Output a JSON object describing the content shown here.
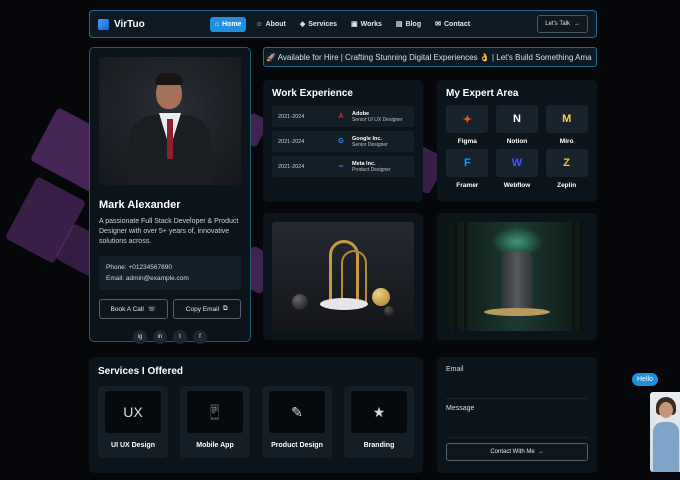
{
  "nav": {
    "logo": "VirTuo",
    "links": [
      {
        "label": "Home",
        "icon": "home-icon",
        "glyph": "⌂"
      },
      {
        "label": "About",
        "icon": "user-icon",
        "glyph": "☺"
      },
      {
        "label": "Services",
        "icon": "layers-icon",
        "glyph": "◈"
      },
      {
        "label": "Works",
        "icon": "briefcase-icon",
        "glyph": "▣"
      },
      {
        "label": "Blog",
        "icon": "book-icon",
        "glyph": "▤"
      },
      {
        "label": "Contact",
        "icon": "mail-icon",
        "glyph": "✉"
      }
    ],
    "cta": "Let's Talk",
    "cta_arrow": "→"
  },
  "marquee": "🚀 Available for Hire | Crafting Stunning Digital Experiences 👌 | Let's Build Something Ama",
  "profile": {
    "name": "Mark Alexander",
    "bio": "A passionate Full Stack Developer & Product Designer with over 5+ years of, innovative solutions across.",
    "phone": "Phone: +01234567890",
    "email": "Email: admin@example.com",
    "book_btn": "Book A Call",
    "copy_btn": "Copy Email",
    "socials": [
      "ig",
      "in",
      "t",
      "f"
    ]
  },
  "work": {
    "title": "Work Experience",
    "items": [
      {
        "years": "2021-2024",
        "company": "Adobe",
        "role": "Senior UI UX Designer",
        "glyph": "A",
        "color": "#e0301e"
      },
      {
        "years": "2021-2024",
        "company": "Google Inc.",
        "role": "Senior Designer",
        "glyph": "G",
        "color": "#4285f4"
      },
      {
        "years": "2021-2024",
        "company": "Meta Inc.",
        "role": "Product Designer",
        "glyph": "∞",
        "color": "#1d7cf2"
      }
    ]
  },
  "expert": {
    "title": "My Expert Area",
    "items": [
      {
        "label": "Figma",
        "glyph": "✦",
        "color": "#f24e1e"
      },
      {
        "label": "Notion",
        "glyph": "N",
        "color": "#ffffff"
      },
      {
        "label": "Miro",
        "glyph": "M",
        "color": "#ffd02f"
      },
      {
        "label": "Framer",
        "glyph": "F",
        "color": "#0aa2ff"
      },
      {
        "label": "Webflow",
        "glyph": "W",
        "color": "#4353ff"
      },
      {
        "label": "Zeplin",
        "glyph": "Z",
        "color": "#fdbd39"
      }
    ]
  },
  "services": {
    "title": "Services I Offered",
    "items": [
      {
        "label": "UI UX Design",
        "glyph": "UX"
      },
      {
        "label": "Mobile App",
        "glyph": "📱"
      },
      {
        "label": "Product Design",
        "glyph": "✎"
      },
      {
        "label": "Branding",
        "glyph": "★"
      }
    ]
  },
  "contact": {
    "email_label": "Email",
    "message_label": "Message",
    "submit": "Contact With Me",
    "submit_arrow": "→"
  },
  "chat": {
    "bubble": "Hello"
  }
}
